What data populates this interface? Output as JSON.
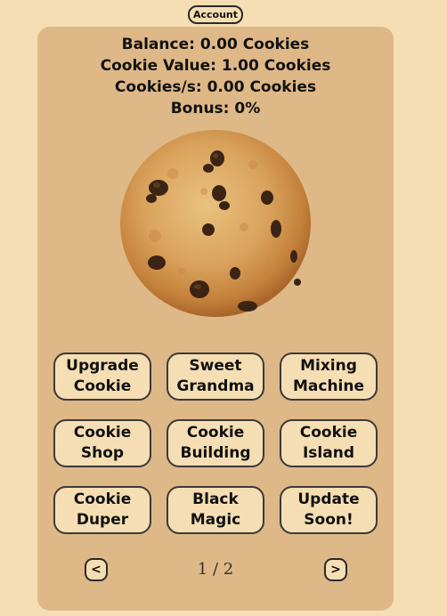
{
  "header": {
    "account_label": "Account"
  },
  "stats": {
    "balance": "Balance: 0.00 Cookies",
    "cookie_value": "Cookie Value: 1.00 Cookies",
    "cookies_per_second": "Cookies/s: 0.00 Cookies",
    "bonus": "Bonus: 0%"
  },
  "cookie": {
    "icon": "chocolate-chip-cookie"
  },
  "upgrades": [
    {
      "line1": "Upgrade",
      "line2": "Cookie"
    },
    {
      "line1": "Sweet",
      "line2": "Grandma"
    },
    {
      "line1": "Mixing",
      "line2": "Machine"
    },
    {
      "line1": "Cookie",
      "line2": "Shop"
    },
    {
      "line1": "Cookie",
      "line2": "Building"
    },
    {
      "line1": "Cookie",
      "line2": "Island"
    },
    {
      "line1": "Cookie",
      "line2": "Duper"
    },
    {
      "line1": "Black",
      "line2": "Magic"
    },
    {
      "line1": "Update",
      "line2": "Soon!"
    }
  ],
  "pagination": {
    "prev_label": "<",
    "next_label": ">",
    "page_text": "1 / 2"
  },
  "colors": {
    "background": "#f5deb3",
    "panel": "#deb887",
    "button_fill": "#f5deb3",
    "border": "#2a2a2a"
  }
}
